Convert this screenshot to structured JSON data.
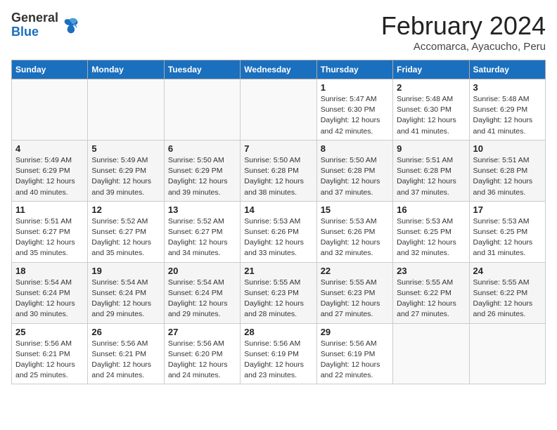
{
  "header": {
    "logo_general": "General",
    "logo_blue": "Blue",
    "month_title": "February 2024",
    "location": "Accomarca, Ayacucho, Peru"
  },
  "days_of_week": [
    "Sunday",
    "Monday",
    "Tuesday",
    "Wednesday",
    "Thursday",
    "Friday",
    "Saturday"
  ],
  "weeks": [
    [
      {
        "day": "",
        "info": ""
      },
      {
        "day": "",
        "info": ""
      },
      {
        "day": "",
        "info": ""
      },
      {
        "day": "",
        "info": ""
      },
      {
        "day": "1",
        "info": "Sunrise: 5:47 AM\nSunset: 6:30 PM\nDaylight: 12 hours\nand 42 minutes."
      },
      {
        "day": "2",
        "info": "Sunrise: 5:48 AM\nSunset: 6:30 PM\nDaylight: 12 hours\nand 41 minutes."
      },
      {
        "day": "3",
        "info": "Sunrise: 5:48 AM\nSunset: 6:29 PM\nDaylight: 12 hours\nand 41 minutes."
      }
    ],
    [
      {
        "day": "4",
        "info": "Sunrise: 5:49 AM\nSunset: 6:29 PM\nDaylight: 12 hours\nand 40 minutes."
      },
      {
        "day": "5",
        "info": "Sunrise: 5:49 AM\nSunset: 6:29 PM\nDaylight: 12 hours\nand 39 minutes."
      },
      {
        "day": "6",
        "info": "Sunrise: 5:50 AM\nSunset: 6:29 PM\nDaylight: 12 hours\nand 39 minutes."
      },
      {
        "day": "7",
        "info": "Sunrise: 5:50 AM\nSunset: 6:28 PM\nDaylight: 12 hours\nand 38 minutes."
      },
      {
        "day": "8",
        "info": "Sunrise: 5:50 AM\nSunset: 6:28 PM\nDaylight: 12 hours\nand 37 minutes."
      },
      {
        "day": "9",
        "info": "Sunrise: 5:51 AM\nSunset: 6:28 PM\nDaylight: 12 hours\nand 37 minutes."
      },
      {
        "day": "10",
        "info": "Sunrise: 5:51 AM\nSunset: 6:28 PM\nDaylight: 12 hours\nand 36 minutes."
      }
    ],
    [
      {
        "day": "11",
        "info": "Sunrise: 5:51 AM\nSunset: 6:27 PM\nDaylight: 12 hours\nand 35 minutes."
      },
      {
        "day": "12",
        "info": "Sunrise: 5:52 AM\nSunset: 6:27 PM\nDaylight: 12 hours\nand 35 minutes."
      },
      {
        "day": "13",
        "info": "Sunrise: 5:52 AM\nSunset: 6:27 PM\nDaylight: 12 hours\nand 34 minutes."
      },
      {
        "day": "14",
        "info": "Sunrise: 5:53 AM\nSunset: 6:26 PM\nDaylight: 12 hours\nand 33 minutes."
      },
      {
        "day": "15",
        "info": "Sunrise: 5:53 AM\nSunset: 6:26 PM\nDaylight: 12 hours\nand 32 minutes."
      },
      {
        "day": "16",
        "info": "Sunrise: 5:53 AM\nSunset: 6:25 PM\nDaylight: 12 hours\nand 32 minutes."
      },
      {
        "day": "17",
        "info": "Sunrise: 5:53 AM\nSunset: 6:25 PM\nDaylight: 12 hours\nand 31 minutes."
      }
    ],
    [
      {
        "day": "18",
        "info": "Sunrise: 5:54 AM\nSunset: 6:24 PM\nDaylight: 12 hours\nand 30 minutes."
      },
      {
        "day": "19",
        "info": "Sunrise: 5:54 AM\nSunset: 6:24 PM\nDaylight: 12 hours\nand 29 minutes."
      },
      {
        "day": "20",
        "info": "Sunrise: 5:54 AM\nSunset: 6:24 PM\nDaylight: 12 hours\nand 29 minutes."
      },
      {
        "day": "21",
        "info": "Sunrise: 5:55 AM\nSunset: 6:23 PM\nDaylight: 12 hours\nand 28 minutes."
      },
      {
        "day": "22",
        "info": "Sunrise: 5:55 AM\nSunset: 6:23 PM\nDaylight: 12 hours\nand 27 minutes."
      },
      {
        "day": "23",
        "info": "Sunrise: 5:55 AM\nSunset: 6:22 PM\nDaylight: 12 hours\nand 27 minutes."
      },
      {
        "day": "24",
        "info": "Sunrise: 5:55 AM\nSunset: 6:22 PM\nDaylight: 12 hours\nand 26 minutes."
      }
    ],
    [
      {
        "day": "25",
        "info": "Sunrise: 5:56 AM\nSunset: 6:21 PM\nDaylight: 12 hours\nand 25 minutes."
      },
      {
        "day": "26",
        "info": "Sunrise: 5:56 AM\nSunset: 6:21 PM\nDaylight: 12 hours\nand 24 minutes."
      },
      {
        "day": "27",
        "info": "Sunrise: 5:56 AM\nSunset: 6:20 PM\nDaylight: 12 hours\nand 24 minutes."
      },
      {
        "day": "28",
        "info": "Sunrise: 5:56 AM\nSunset: 6:19 PM\nDaylight: 12 hours\nand 23 minutes."
      },
      {
        "day": "29",
        "info": "Sunrise: 5:56 AM\nSunset: 6:19 PM\nDaylight: 12 hours\nand 22 minutes."
      },
      {
        "day": "",
        "info": ""
      },
      {
        "day": "",
        "info": ""
      }
    ]
  ]
}
